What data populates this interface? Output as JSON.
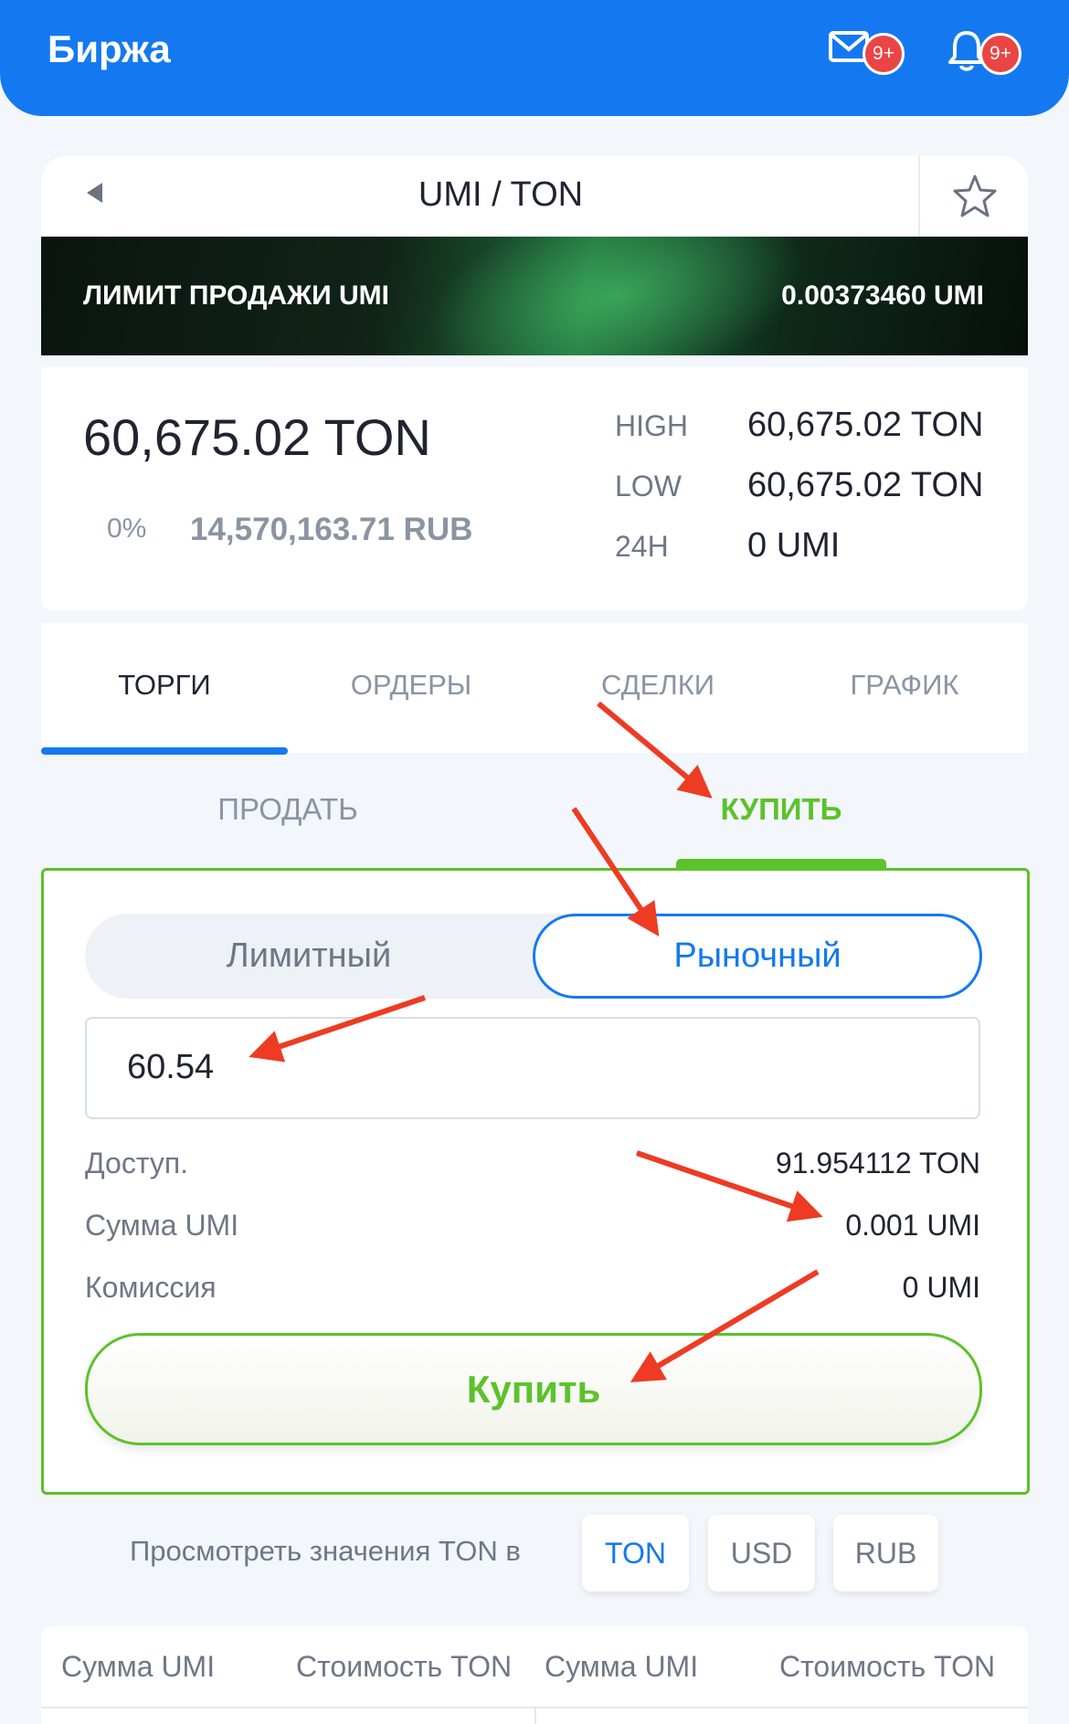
{
  "header": {
    "title": "Биржа",
    "mail_badge": "9+",
    "bell_badge": "9+"
  },
  "pair": {
    "name": "UMI / TON"
  },
  "banner": {
    "label": "ЛИМИТ ПРОДАЖИ UMI",
    "value": "0.00373460 UMI"
  },
  "stats": {
    "price": "60,675.02 TON",
    "change": "0%",
    "price_rub": "14,570,163.71 RUB",
    "high_label": "HIGH",
    "high_value": "60,675.02 TON",
    "low_label": "LOW",
    "low_value": "60,675.02 TON",
    "vol_label": "24H",
    "vol_value": "0 UMI"
  },
  "tabs": [
    "ТОРГИ",
    "ОРДЕРЫ",
    "СДЕЛКИ",
    "ГРАФИК"
  ],
  "sides": {
    "sell": "ПРОДАТЬ",
    "buy": "КУПИТЬ"
  },
  "order": {
    "type_limit": "Лимитный",
    "type_market": "Рыночный",
    "amount": "60.54",
    "available_label": "Доступ.",
    "available_value": "91.954112 TON",
    "sum_label": "Сумма UMI",
    "sum_value": "0.001 UMI",
    "fee_label": "Комиссия",
    "fee_value": "0 UMI",
    "buy_button": "Купить"
  },
  "view": {
    "label": "Просмотреть значения TON в",
    "options": [
      "TON",
      "USD",
      "RUB"
    ]
  },
  "table": {
    "headers": [
      "Сумма UMI",
      "Стоимость TON",
      "Сумма UMI",
      "Стоимость TON"
    ]
  },
  "colors": {
    "primary": "#1479f0",
    "buy": "#5cc22b",
    "annotation": "#ee3b24"
  }
}
